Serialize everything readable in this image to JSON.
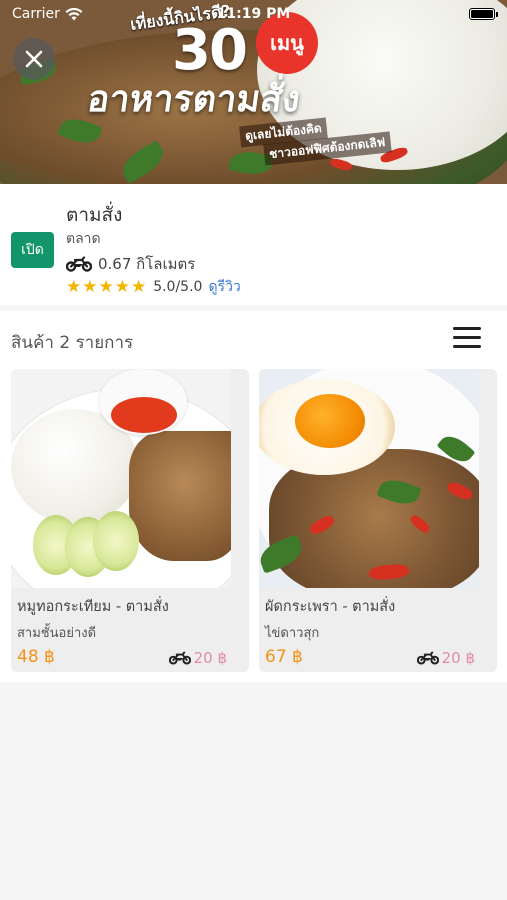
{
  "status_bar": {
    "carrier": "Carrier",
    "time": "11:19 PM"
  },
  "banner": {
    "tagline": "เที่ยงนี้กินไรดี?",
    "number": "30",
    "menu_badge": "เมนู",
    "headline": "อาหารตามสั่ง",
    "sub1": "ดูเลยไม่ต้องคิด",
    "sub2": "ชาวออฟฟิศต้องกดเลิฟ"
  },
  "store": {
    "status_badge": "เปิด",
    "name": "ตามสั่ง",
    "category": "ตลาด",
    "distance": "0.67 กิโลเมตร",
    "rating_stars": 5,
    "rating_text": "5.0/5.0",
    "review_link": "ดูรีวิว",
    "colors": {
      "open_badge": "#12956a",
      "star": "#f5b400",
      "link": "#3a78d8"
    }
  },
  "products": {
    "header": "สินค้า 2 รายการ",
    "items": [
      {
        "title": "หมูทอกระเทียม - ตามสั่ง",
        "subtitle": "สามชั้นอย่างดี",
        "price": "48 ฿",
        "delivery_fee": "20 ฿"
      },
      {
        "title": "ผัดกระเพรา - ตามสั่ง",
        "subtitle": "ไข่ดาวสุก",
        "price": "67 ฿",
        "delivery_fee": "20 ฿"
      }
    ],
    "colors": {
      "price": "#f39419",
      "fee": "#e48ba6"
    }
  },
  "icons": {
    "close": "close-icon",
    "menu": "hamburger-menu-icon",
    "motorbike": "motorbike-icon",
    "wifi": "wifi-icon",
    "battery": "battery-icon"
  }
}
